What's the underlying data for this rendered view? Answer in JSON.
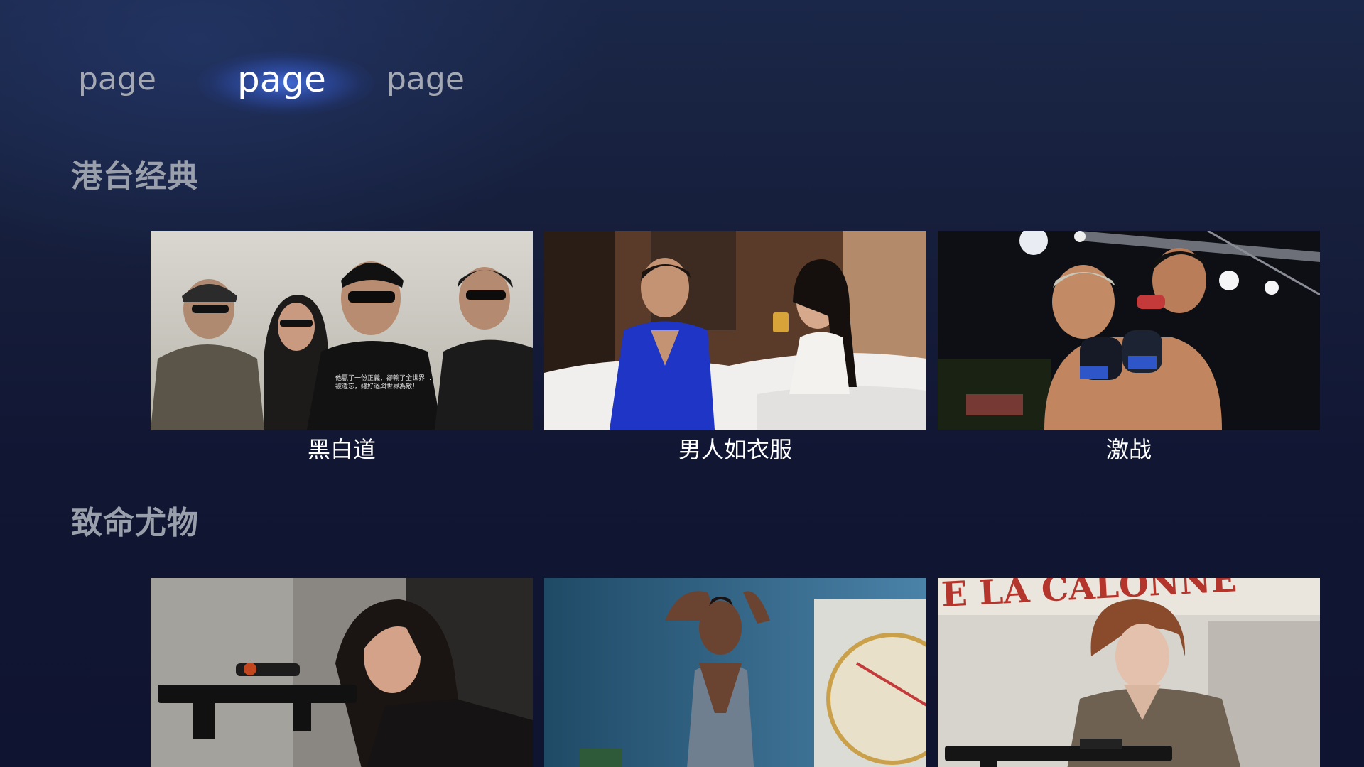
{
  "tabs": [
    {
      "label": "page",
      "active": false
    },
    {
      "label": "page",
      "active": true
    },
    {
      "label": "page",
      "active": false
    }
  ],
  "sections": [
    {
      "title": "港台经典",
      "items": [
        {
          "title": "黑白道",
          "poster_caption_line1": "他贏了一份正義，卻輸了全世界…",
          "poster_caption_line2": "被遺忘，總好過與世界為敵！"
        },
        {
          "title": "男人如衣服"
        },
        {
          "title": "激战"
        }
      ]
    },
    {
      "title": "致命尤物",
      "items": [
        {
          "title": ""
        },
        {
          "title": ""
        },
        {
          "title": "",
          "poster_sign_text": "E LA CALONNE"
        }
      ]
    }
  ],
  "colors": {
    "background_top": "#1b2748",
    "background_bottom": "#0f1430",
    "active_tab_glow": "#4a76eb",
    "inactive_tab": "#a3a8b3",
    "section_title": "#9aa0ab"
  }
}
